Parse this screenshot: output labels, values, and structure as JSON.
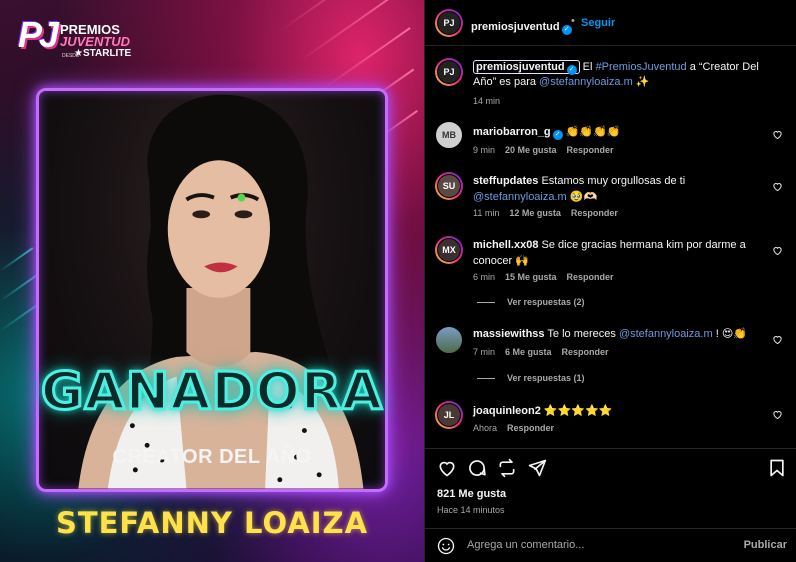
{
  "post_image": {
    "logo": {
      "pj": "PJ",
      "premios": "PREMIOS",
      "juventud": "JUVENTUD",
      "desde": "DESDE",
      "starlite": "★STARLITE"
    },
    "headline": "GANADORA",
    "category": "CREATOR DEL AÑO",
    "winner": "STEFANNY LOAIZA",
    "colors": {
      "frame_neon": "#c76bff",
      "headline_neon": "#4df0e0",
      "winner_yellow": "#ffe14a"
    }
  },
  "header": {
    "username": "premiosjuventud",
    "separator": "•",
    "follow_label": "Seguir"
  },
  "caption": {
    "username": "premiosjuventud",
    "text_before": " El ",
    "hashtag": "#PremiosJuventud",
    "text_middle": " a “Creator Del Año” es para ",
    "mention": "@stefannyloaiza.m",
    "emoji": " ✨",
    "time": "14 min"
  },
  "comments": [
    {
      "username": "mariobarron_g",
      "verified": true,
      "text": "👏👏👏👏",
      "time": "9 min",
      "likes": "20 Me gusta",
      "reply": "Responder",
      "view_replies": ""
    },
    {
      "username": "steffupdates",
      "verified": false,
      "text": "Estamos muy orgullosas de ti ",
      "mention": "@stefannyloaiza.m",
      "text_after": " 🥹🫶🏻",
      "time": "11 min",
      "likes": "12 Me gusta",
      "reply": "Responder",
      "view_replies": ""
    },
    {
      "username": "michell.xx08",
      "verified": false,
      "text": "Se dice gracias hermana kim por darme a conocer 🙌",
      "time": "6 min",
      "likes": "15 Me gusta",
      "reply": "Responder",
      "view_replies": "Ver respuestas (2)"
    },
    {
      "username": "massiewithss",
      "verified": false,
      "text": "Te lo mereces ",
      "mention": "@stefannyloaiza.m",
      "text_after": " ! 😍👏",
      "time": "7 min",
      "likes": "6 Me gusta",
      "reply": "Responder",
      "view_replies": "Ver respuestas (1)"
    },
    {
      "username": "joaquinleon2",
      "verified": false,
      "text": "⭐⭐⭐⭐⭐",
      "time": "Ahora",
      "likes": "",
      "reply": "Responder",
      "view_replies": ""
    }
  ],
  "actions": {
    "likes": "821 Me gusta",
    "time_ago": "Hace 14 minutos"
  },
  "comment_box": {
    "placeholder": "Agrega un comentario...",
    "publish_label": "Publicar"
  },
  "icons": [
    "like-icon",
    "comment-icon",
    "repost-icon",
    "share-icon",
    "save-icon",
    "emoji-icon",
    "small-heart-icon",
    "verified-icon"
  ]
}
